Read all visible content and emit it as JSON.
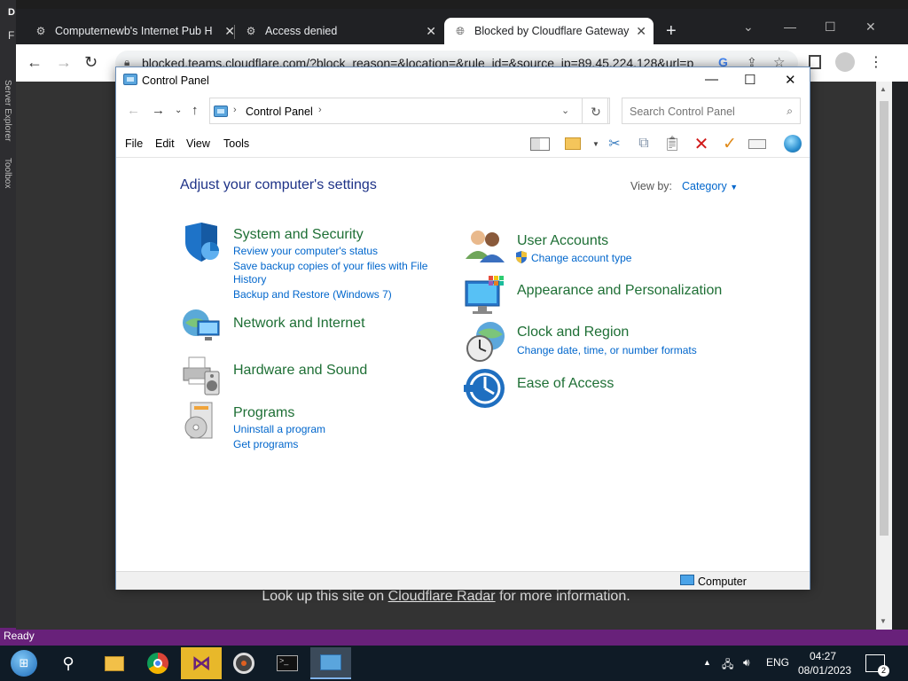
{
  "ide": {
    "top_glyph": "D",
    "menu_f": "F",
    "side_labels": [
      "Server Explorer",
      "Toolbox"
    ],
    "status": "Ready"
  },
  "browser": {
    "tabs": [
      {
        "title": "Computernewb's Internet Pub H",
        "close": "✕"
      },
      {
        "title": "Access denied",
        "close": "✕"
      },
      {
        "title": "Blocked by Cloudflare Gateway",
        "close": "✕"
      }
    ],
    "new_tab": "+",
    "url": "blocked.teams.cloudflare.com/?block_reason=&location=&rule_id=&source_ip=89.45.224.128&url=p",
    "page_text_before": "Look up this site on",
    "page_link": "Cloudflare Radar",
    "page_text_after": "for more information."
  },
  "control_panel": {
    "title": "Control Panel",
    "breadcrumb": "Control Panel",
    "search_placeholder": "Search Control Panel",
    "menu": [
      "File",
      "Edit",
      "View",
      "Tools"
    ],
    "heading": "Adjust your computer's settings",
    "view_by_label": "View by:",
    "view_by_value": "Category",
    "categories": [
      {
        "title": "System and Security",
        "links": [
          "Review your computer's status",
          "Save backup copies of your files with File",
          "History",
          "Backup and Restore (Windows 7)"
        ],
        "icon": "shield-icon"
      },
      {
        "title": "Network and Internet",
        "links": [],
        "icon": "network-globe-icon"
      },
      {
        "title": "Hardware and Sound",
        "links": [],
        "icon": "printer-speaker-icon"
      },
      {
        "title": "Programs",
        "links": [
          "Uninstall a program",
          "Get programs"
        ],
        "icon": "programs-disc-icon"
      },
      {
        "title": "User Accounts",
        "links": [
          "Change account type"
        ],
        "icon": "users-icon"
      },
      {
        "title": "Appearance and Personalization",
        "links": [],
        "icon": "monitor-palette-icon"
      },
      {
        "title": "Clock and Region",
        "links": [
          "Change date, time, or number formats"
        ],
        "icon": "clock-globe-icon"
      },
      {
        "title": "Ease of Access",
        "links": [],
        "icon": "ease-of-access-icon"
      }
    ],
    "status_location": "Computer"
  },
  "taskbar": {
    "language": "ENG",
    "time": "04:27",
    "date": "08/01/2023",
    "notifications": "2"
  }
}
